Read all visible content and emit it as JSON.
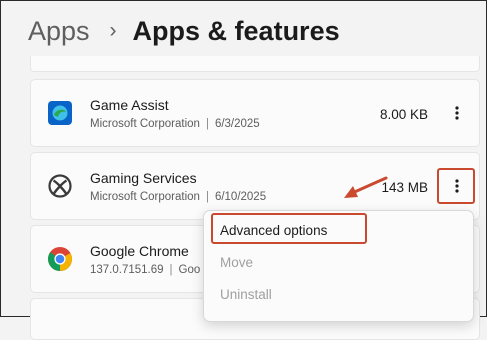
{
  "breadcrumb": {
    "parent": "Apps",
    "separator": "›",
    "title": "Apps & features"
  },
  "apps": [
    {
      "name": "Game Assist",
      "publisher": "Microsoft Corporation",
      "separator": "|",
      "date": "6/3/2025",
      "size": "8.00 KB",
      "icon": "game-assist-icon"
    },
    {
      "name": "Gaming Services",
      "publisher": "Microsoft Corporation",
      "separator": "|",
      "date": "6/10/2025",
      "size": "143 MB",
      "icon": "xbox-icon"
    },
    {
      "name": "Google Chrome",
      "version": "137.0.7151.69",
      "separator": "|",
      "publisher": "Goo",
      "icon": "chrome-icon"
    }
  ],
  "context_menu": {
    "items": [
      {
        "label": "Advanced options",
        "enabled": true
      },
      {
        "label": "Move",
        "enabled": false
      },
      {
        "label": "Uninstall",
        "enabled": false
      }
    ]
  },
  "colors": {
    "annotation": "#c94a2f",
    "background": "#f3f3f3",
    "card": "#fbfbfb",
    "disabled_text": "#a0a0a0"
  }
}
